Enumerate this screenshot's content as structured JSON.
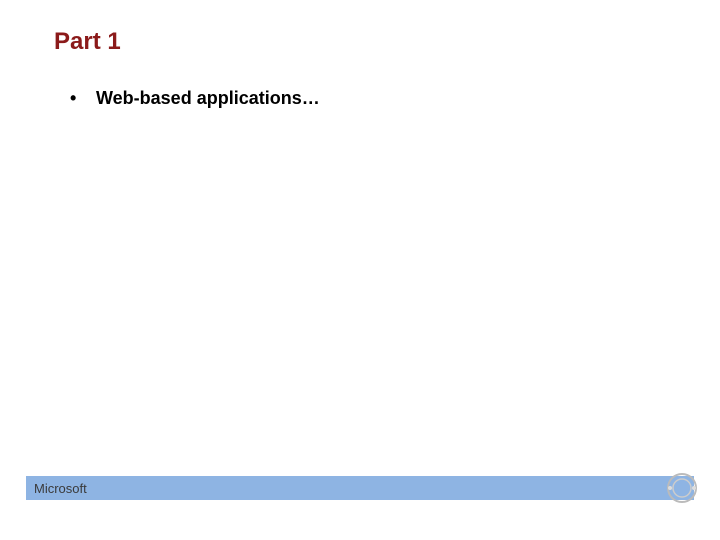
{
  "slide": {
    "title": "Part 1",
    "bullets": [
      "Web-based applications…"
    ]
  },
  "footer": {
    "logo_text": "Microsoft"
  }
}
